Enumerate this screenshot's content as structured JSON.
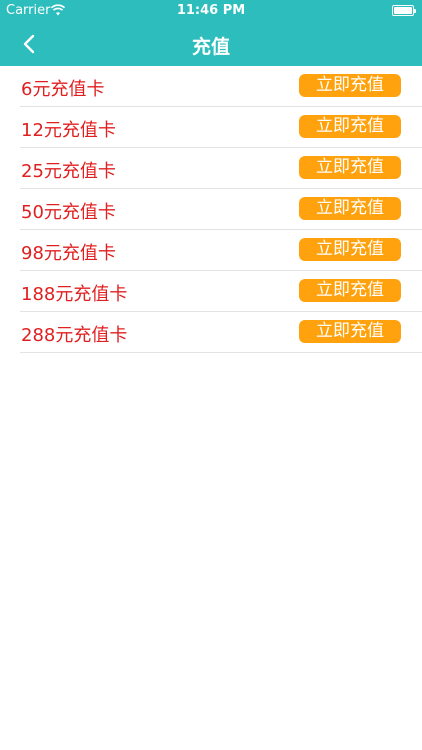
{
  "status_bar": {
    "carrier": "Carrier",
    "time": "11:46 PM"
  },
  "nav": {
    "title": "充值"
  },
  "colors": {
    "header": "#2dbdbd",
    "label": "#e02020",
    "button": "#ffa20d"
  },
  "cards": [
    {
      "label": "6元充值卡",
      "button": "立即充值"
    },
    {
      "label": "12元充值卡",
      "button": "立即充值"
    },
    {
      "label": "25元充值卡",
      "button": "立即充值"
    },
    {
      "label": "50元充值卡",
      "button": "立即充值"
    },
    {
      "label": "98元充值卡",
      "button": "立即充值"
    },
    {
      "label": "188元充值卡",
      "button": "立即充值"
    },
    {
      "label": "288元充值卡",
      "button": "立即充值"
    }
  ]
}
